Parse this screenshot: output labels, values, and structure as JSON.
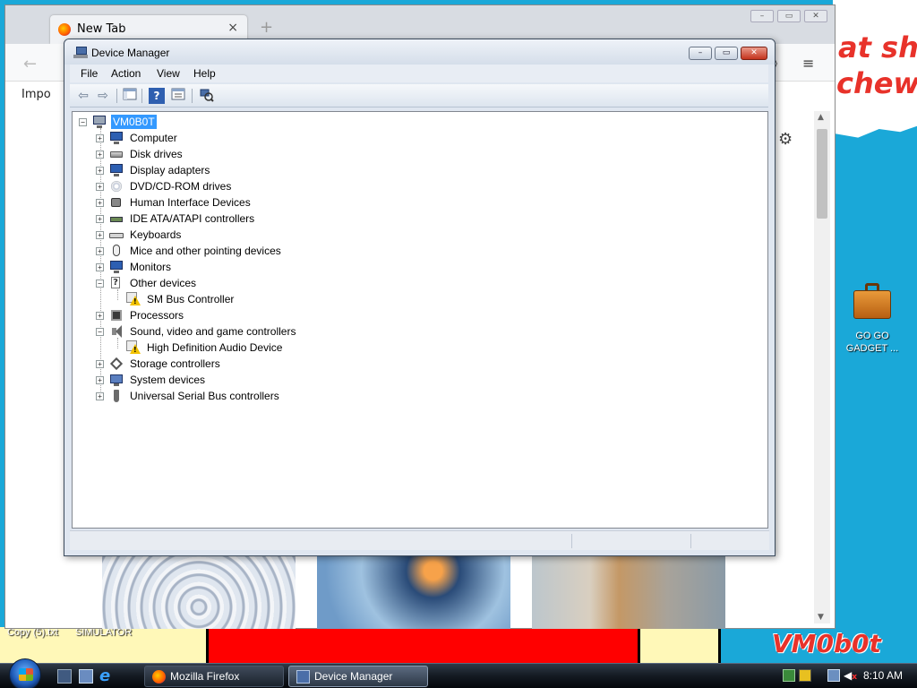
{
  "desktop": {
    "wallpaper_text_1": "at shit",
    "wallpaper_text_2": "chew",
    "signature": "VM0b0t",
    "label_left": "Copy (5).txt",
    "label_mid": "SIMULATOR",
    "icon": {
      "name": "briefcase-icon",
      "label_line1": "GO GO",
      "label_line2": "GADGET ..."
    }
  },
  "firefox": {
    "tab_title": "New Tab",
    "tab_close": "×",
    "new_tab": "+",
    "back": "←",
    "bookmarks_label": "Impo",
    "menu": "≡",
    "gear": "⚙"
  },
  "device_manager": {
    "title": "Device Manager",
    "window_buttons": {
      "minimize": "–",
      "maximize": "▭",
      "close": "✕"
    },
    "menu": [
      "File",
      "Action",
      "View",
      "Help"
    ],
    "toolbar": {
      "back_icon": "arrow-left-icon",
      "forward_icon": "arrow-right-icon",
      "show_hide_icon": "console-tree-icon",
      "help_icon": "help-icon",
      "properties_icon": "properties-icon",
      "scan_icon": "scan-hardware-icon",
      "help_glyph": "?"
    },
    "tree": {
      "root": "VM0B0T",
      "items": [
        {
          "label": "Computer",
          "icon": "computer-icon",
          "expanded": false
        },
        {
          "label": "Disk drives",
          "icon": "disk-drive-icon",
          "expanded": false
        },
        {
          "label": "Display adapters",
          "icon": "display-adapter-icon",
          "expanded": false
        },
        {
          "label": "DVD/CD-ROM drives",
          "icon": "cd-drive-icon",
          "expanded": false
        },
        {
          "label": "Human Interface Devices",
          "icon": "hid-icon",
          "expanded": false
        },
        {
          "label": "IDE ATA/ATAPI controllers",
          "icon": "ide-controller-icon",
          "expanded": false
        },
        {
          "label": "Keyboards",
          "icon": "keyboard-icon",
          "expanded": false
        },
        {
          "label": "Mice and other pointing devices",
          "icon": "mouse-icon",
          "expanded": false
        },
        {
          "label": "Monitors",
          "icon": "monitor-icon",
          "expanded": false
        },
        {
          "label": "Other devices",
          "icon": "unknown-device-icon",
          "expanded": true,
          "children": [
            {
              "label": "SM Bus Controller",
              "icon": "warning-device-icon"
            }
          ]
        },
        {
          "label": "Processors",
          "icon": "processor-icon",
          "expanded": false
        },
        {
          "label": "Sound, video and game controllers",
          "icon": "speaker-icon",
          "expanded": true,
          "children": [
            {
              "label": "High Definition Audio Device",
              "icon": "warning-device-icon"
            }
          ]
        },
        {
          "label": "Storage controllers",
          "icon": "storage-controller-icon",
          "expanded": false
        },
        {
          "label": "System devices",
          "icon": "system-device-icon",
          "expanded": false
        },
        {
          "label": "Universal Serial Bus controllers",
          "icon": "usb-icon",
          "expanded": false
        }
      ]
    },
    "expander_collapsed": "+",
    "expander_expanded": "−"
  },
  "taskbar": {
    "buttons": [
      {
        "label": "Mozilla Firefox",
        "icon": "firefox-icon",
        "active": false
      },
      {
        "label": "Device Manager",
        "icon": "device-manager-icon",
        "active": true
      }
    ],
    "quick_launch": [
      "show-desktop-icon",
      "switch-windows-icon",
      "internet-explorer-icon"
    ],
    "ie_glyph": "e",
    "clock": "8:10 AM",
    "volume_glyph": "◀",
    "volume_muted_glyph": "x"
  },
  "colors": {
    "desktop_blue": "#1aa8d8",
    "selection": "#3399ff",
    "wallpaper_red": "#ff0000",
    "warning_yellow": "#f2c200"
  }
}
